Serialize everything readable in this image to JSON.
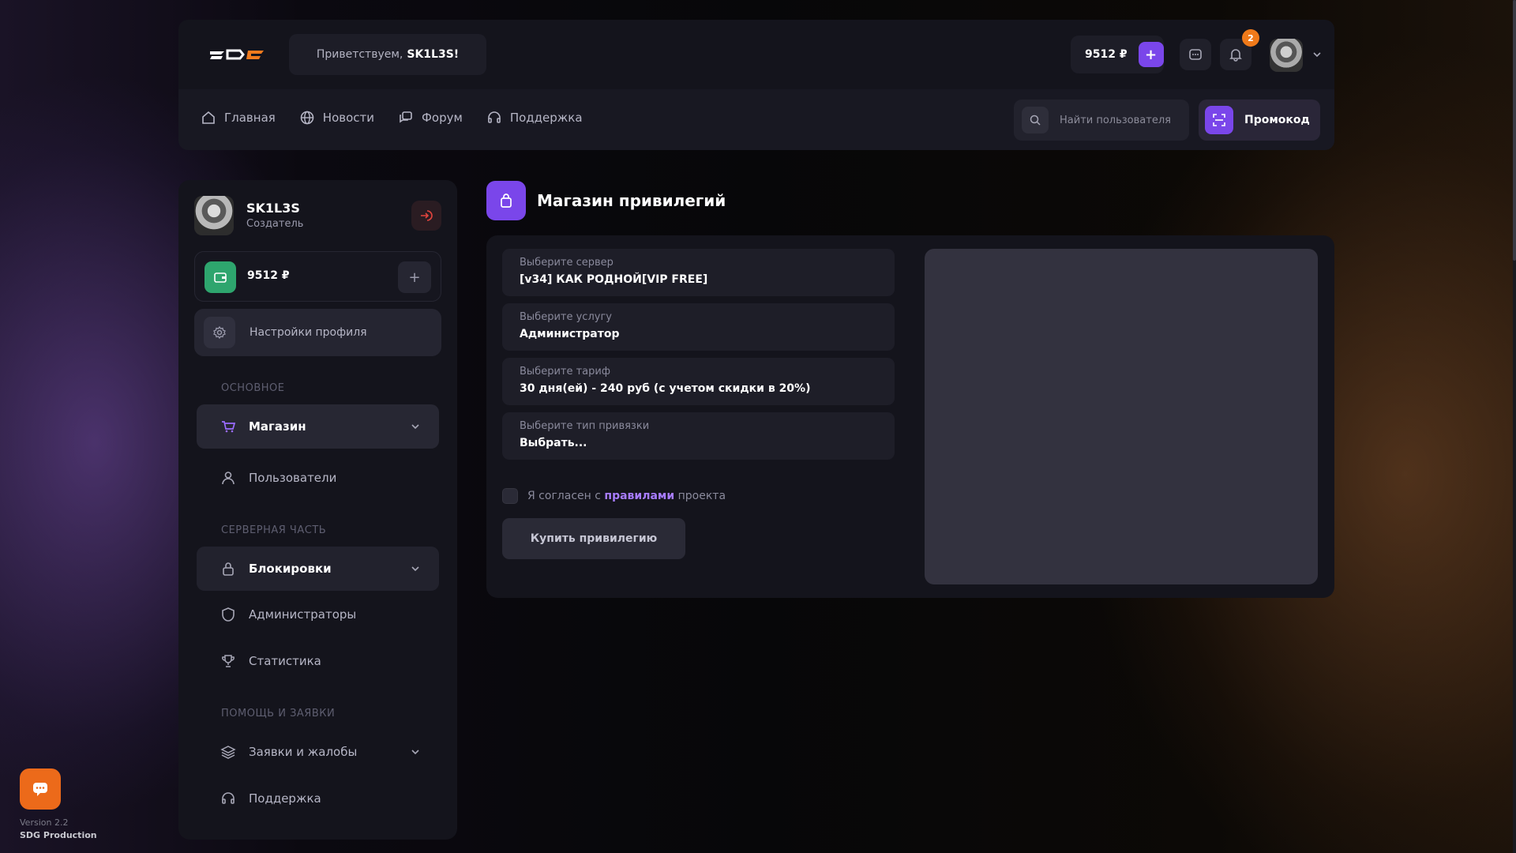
{
  "header": {
    "greeting_prefix": "Приветствуем,",
    "greeting_user": "SK1L3S!",
    "balance": "9512 ₽",
    "notifications_count": "2"
  },
  "nav": {
    "items": [
      {
        "label": "Главная",
        "icon": "home-icon"
      },
      {
        "label": "Новости",
        "icon": "globe-icon"
      },
      {
        "label": "Форум",
        "icon": "chat-bubbles-icon"
      },
      {
        "label": "Поддержка",
        "icon": "headset-icon"
      }
    ],
    "search_placeholder": "Найти пользователя",
    "promo_label": "Промокод"
  },
  "sidebar": {
    "user_name": "SK1L3S",
    "user_role": "Создатель",
    "wallet_amount": "9512 ₽",
    "settings_label": "Настройки профиля",
    "sections": {
      "main": "ОСНОВНОЕ",
      "server": "СЕРВЕРНАЯ ЧАСТЬ",
      "help": "ПОМОЩЬ И ЗАЯВКИ"
    },
    "items": {
      "shop": "Магазин",
      "users": "Пользователи",
      "bans": "Блокировки",
      "admins": "Администраторы",
      "stats": "Статистика",
      "tickets": "Заявки и жалобы",
      "support": "Поддержка"
    }
  },
  "main": {
    "title": "Магазин привилегий",
    "fields": [
      {
        "label": "Выберите сервер",
        "value": "[v34] КАК РОДНОЙ[VIP FREE]"
      },
      {
        "label": "Выберите услугу",
        "value": "Администратор"
      },
      {
        "label": "Выберите тариф",
        "value": "30 дня(ей) - 240 руб (с учетом скидки в 20%)"
      },
      {
        "label": "Выберите тип привязки",
        "value": "Выбрать..."
      }
    ],
    "agree_prefix": "Я согласен с",
    "agree_link": "правилами",
    "agree_suffix": "проекта",
    "buy_label": "Купить привилегию"
  },
  "footer": {
    "version": "Version 2.2",
    "production": "SDG Production"
  },
  "colors": {
    "accent": "#7a46ea",
    "wallet_green": "#2ea56e",
    "badge_orange": "#f07a1a",
    "panel": "#14141c"
  }
}
